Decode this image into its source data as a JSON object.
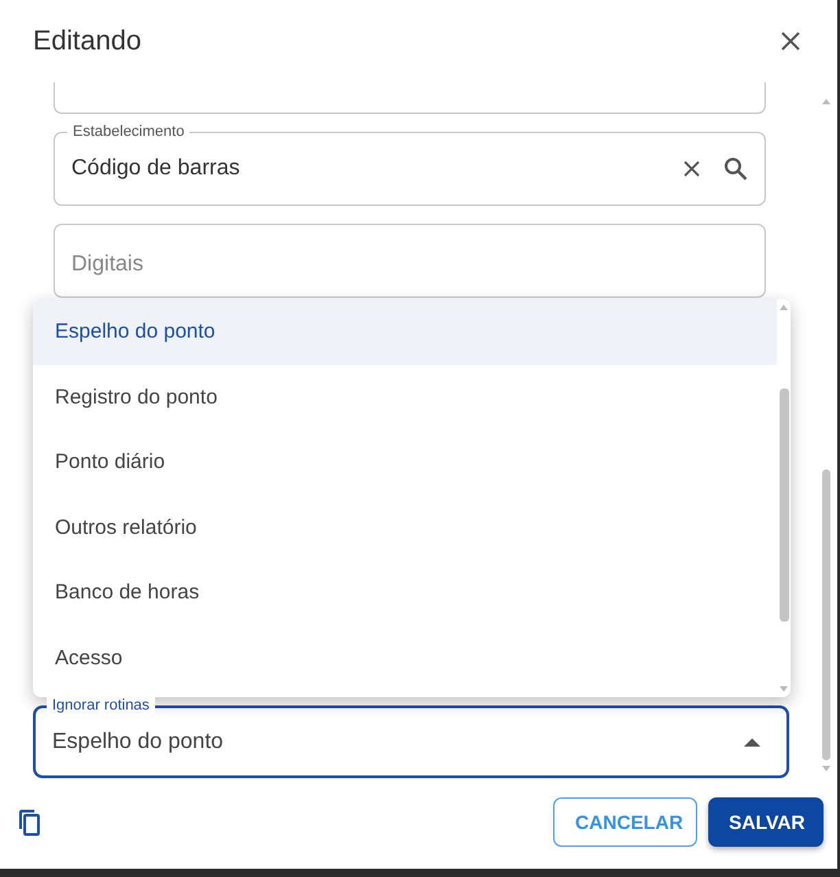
{
  "dialog": {
    "title": "Editando"
  },
  "fields": [
    {
      "kind": "blank"
    },
    {
      "kind": "lookup",
      "label": "Estabelecimento",
      "value": "Código de barras"
    },
    {
      "kind": "text",
      "placeholder": "Digitais"
    }
  ],
  "select": {
    "label": "Ignorar rotinas",
    "value": "Espelho do ponto",
    "expanded": true,
    "options": [
      {
        "label": "Espelho do ponto",
        "selected": true
      },
      {
        "label": "Registro do ponto",
        "selected": false
      },
      {
        "label": "Ponto diário",
        "selected": false
      },
      {
        "label": "Outros relatório",
        "selected": false
      },
      {
        "label": "Banco de horas",
        "selected": false
      },
      {
        "label": "Acesso",
        "selected": false
      }
    ]
  },
  "buttons": [
    {
      "label": "CANCELAR",
      "kind": "outlined"
    },
    {
      "label": "SALVAR",
      "kind": "filled"
    }
  ]
}
